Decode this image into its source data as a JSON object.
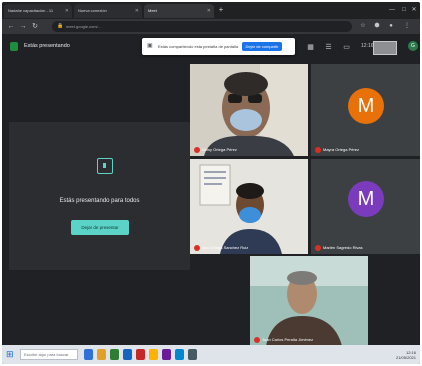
{
  "browser": {
    "tabs": [
      {
        "label": "Nadahe capacitación - 11"
      },
      {
        "label": "Nueva conexión"
      },
      {
        "label": "Meet"
      }
    ],
    "address": "meet.google.com/…"
  },
  "meet": {
    "title": "Estás presentando",
    "clock": "12:16"
  },
  "popup": {
    "text": "Estás compartiendo esta pestaña de pantalla",
    "button": "Dejar de compartir"
  },
  "present": {
    "message": "Estás presentando para todos",
    "stop_button": "Dejar de presentar"
  },
  "participants": [
    {
      "name": "Nelsy Ortega Pérez",
      "type": "video"
    },
    {
      "name": "Mayra Ortega Pérez",
      "type": "avatar",
      "initial": "M",
      "color": "#e8710a"
    },
    {
      "name": "Ana Ortega Sanchez Ruiz",
      "type": "video"
    },
    {
      "name": "Marlén Sagredo Rivas",
      "type": "avatar",
      "initial": "M",
      "color": "#7a3bbd"
    },
    {
      "name": "Juan Carlos Peralta Jiménez",
      "type": "video"
    }
  ],
  "taskbar": {
    "search": "Escribe aquí para buscar",
    "time": "12:16",
    "date": "21/05/2021"
  },
  "icons": [
    "close-icon",
    "back-icon",
    "forward-icon",
    "reload-icon",
    "lock-icon",
    "star-icon",
    "people-icon",
    "chat-icon",
    "windows-icon",
    "mic-off-icon",
    "present-icon"
  ]
}
